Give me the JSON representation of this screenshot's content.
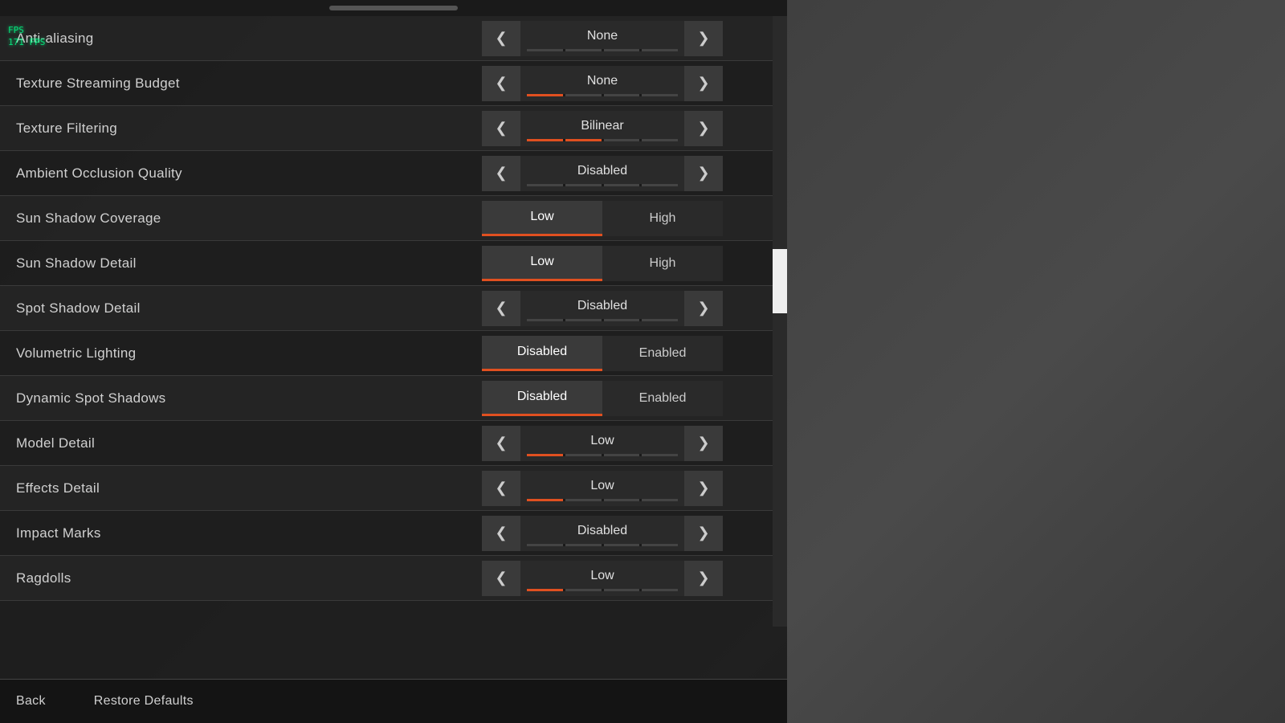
{
  "hud": {
    "fps_label": "171 FPS",
    "line1": "FPS",
    "line2": "171 FPS"
  },
  "settings": [
    {
      "id": "anti-aliasing",
      "label": "Anti-aliasing",
      "control_type": "arrow",
      "value": "None",
      "bar_filled": 0,
      "bar_total": 4
    },
    {
      "id": "texture-streaming-budget",
      "label": "Texture Streaming Budget",
      "control_type": "arrow",
      "value": "None",
      "bar_filled": 1,
      "bar_total": 4
    },
    {
      "id": "texture-filtering",
      "label": "Texture Filtering",
      "control_type": "arrow",
      "value": "Bilinear",
      "bar_filled": 2,
      "bar_total": 4
    },
    {
      "id": "ambient-occlusion-quality",
      "label": "Ambient Occlusion Quality",
      "control_type": "arrow",
      "value": "Disabled",
      "bar_filled": 0,
      "bar_total": 4
    },
    {
      "id": "sun-shadow-coverage",
      "label": "Sun Shadow Coverage",
      "control_type": "toggle",
      "option1": "Low",
      "option2": "High",
      "active": 1
    },
    {
      "id": "sun-shadow-detail",
      "label": "Sun Shadow Detail",
      "control_type": "toggle",
      "option1": "Low",
      "option2": "High",
      "active": 1
    },
    {
      "id": "spot-shadow-detail",
      "label": "Spot Shadow Detail",
      "control_type": "arrow",
      "value": "Disabled",
      "bar_filled": 0,
      "bar_total": 4
    },
    {
      "id": "volumetric-lighting",
      "label": "Volumetric Lighting",
      "control_type": "toggle",
      "option1": "Disabled",
      "option2": "Enabled",
      "active": 1
    },
    {
      "id": "dynamic-spot-shadows",
      "label": "Dynamic Spot Shadows",
      "control_type": "toggle",
      "option1": "Disabled",
      "option2": "Enabled",
      "active": 1
    },
    {
      "id": "model-detail",
      "label": "Model Detail",
      "control_type": "arrow",
      "value": "Low",
      "bar_filled": 1,
      "bar_total": 4
    },
    {
      "id": "effects-detail",
      "label": "Effects Detail",
      "control_type": "arrow",
      "value": "Low",
      "bar_filled": 1,
      "bar_total": 4
    },
    {
      "id": "impact-marks",
      "label": "Impact Marks",
      "control_type": "arrow",
      "value": "Disabled",
      "bar_filled": 0,
      "bar_total": 4
    },
    {
      "id": "ragdolls",
      "label": "Ragdolls",
      "control_type": "arrow",
      "value": "Low",
      "bar_filled": 1,
      "bar_total": 4
    }
  ],
  "bottom": {
    "back_label": "Back",
    "restore_label": "Restore Defaults"
  },
  "arrows": {
    "left": "❮",
    "right": "❯"
  }
}
